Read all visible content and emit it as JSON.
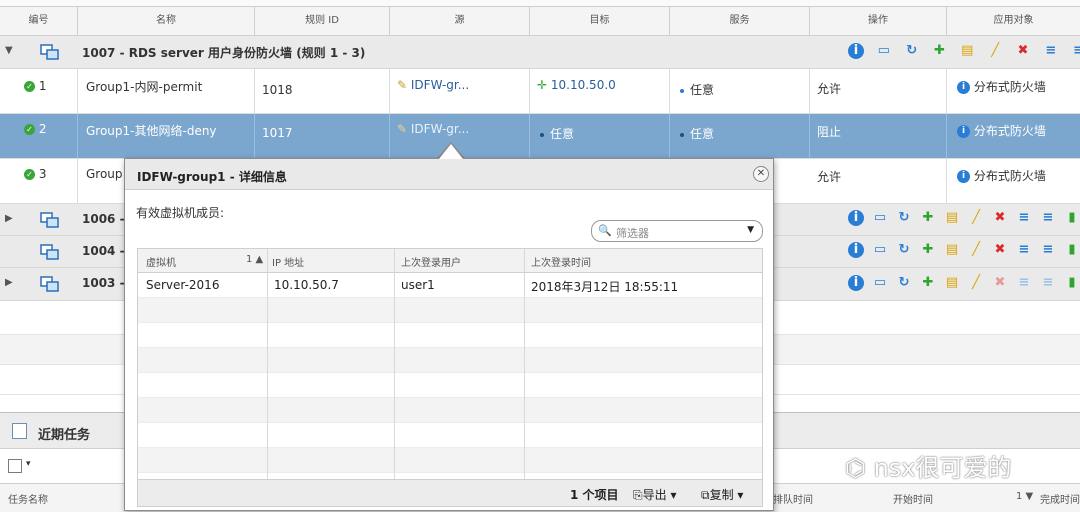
{
  "grid": {
    "columns": [
      "编号",
      "名称",
      "规则 ID",
      "源",
      "目标",
      "服务",
      "操作",
      "应用对象"
    ],
    "sections": [
      {
        "title": "1007 - RDS server 用户身份防火墙 (规则 1 - 3)",
        "expanded": true
      },
      {
        "title": "1006 - I",
        "expanded": false
      },
      {
        "title": "1004 - I",
        "expanded": false
      },
      {
        "title": "1003 - S",
        "expanded": false
      }
    ],
    "rules": [
      {
        "num": "1",
        "name": "Group1-内网-permit",
        "rule_id": "1018",
        "source": "IDFW-gr...",
        "target": "10.10.50.0",
        "service": "任意",
        "action": "允许",
        "applied_to": "分布式防火墙"
      },
      {
        "num": "2",
        "name": "Group1-其他网络-deny",
        "rule_id": "1017",
        "source": "IDFW-gr...",
        "target": "任意",
        "service": "任意",
        "action": "阻止",
        "applied_to": "分布式防火墙"
      },
      {
        "num": "3",
        "name": "Group",
        "rule_id": "",
        "source": "",
        "target": "",
        "service": "",
        "action": "允许",
        "applied_to": "分布式防火墙"
      }
    ]
  },
  "dialog": {
    "title": "IDFW-group1 - 详细信息",
    "subtitle": "有效虚拟机成员:",
    "filter_placeholder": "筛选器",
    "columns": [
      "虚拟机",
      "1 ▲",
      "IP 地址",
      "上次登录用户",
      "上次登录时间"
    ],
    "rows": [
      {
        "vm": "Server-2016",
        "ip": "10.10.50.7",
        "user": "user1",
        "time": "2018年3月12日 18:55:11"
      }
    ],
    "footer": {
      "count": "1 个项目",
      "export": "导出",
      "copy": "复制"
    }
  },
  "tasks": {
    "title": "近期任务",
    "columns": [
      "任务名称",
      "排队时间",
      "开始时间",
      "1 ▼",
      "完成时间"
    ]
  },
  "watermark": "nsx很可爱的",
  "colors": {
    "selected_row": "#7ba7cf",
    "info_blue": "#2a7dd4",
    "ok_green": "#3aa63a",
    "delete_red": "#d92b2b",
    "add_green": "#2ea52e"
  }
}
